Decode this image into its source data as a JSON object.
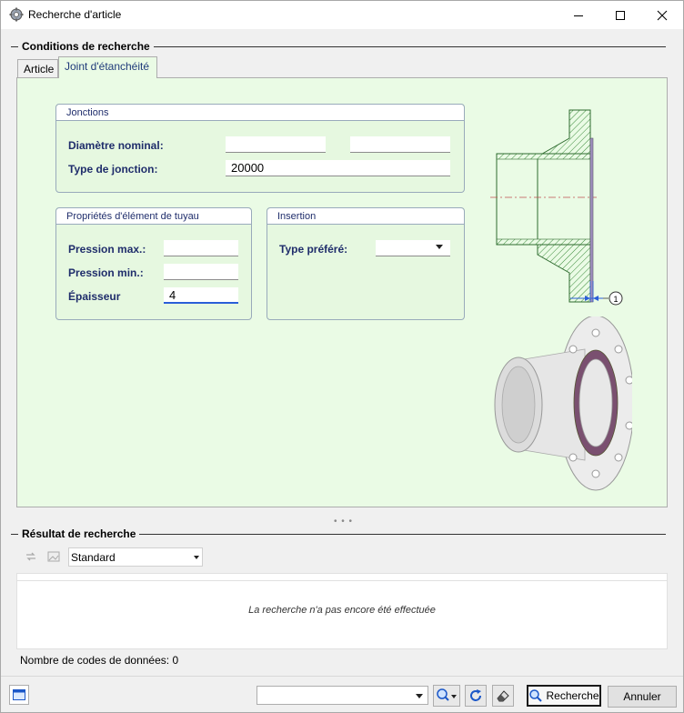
{
  "window": {
    "title": "Recherche d'article"
  },
  "search_conditions": {
    "label": "Conditions de recherche",
    "tabs": [
      {
        "label": "Article",
        "active": false
      },
      {
        "label": "Joint d'étanchéité",
        "active": true
      }
    ],
    "jonctions": {
      "header": "Jonctions",
      "diametre_label": "Diamètre nominal:",
      "diametre_value_1": "",
      "diametre_value_2": "",
      "type_label": "Type de jonction:",
      "type_value": "20000"
    },
    "proprietes": {
      "header": "Propriétés d'élément de tuyau",
      "pression_max_label": "Pression max.:",
      "pression_max_value": "",
      "pression_min_label": "Pression min.:",
      "pression_min_value": "",
      "epaisseur_label": "Épaisseur",
      "epaisseur_value": "4"
    },
    "insertion": {
      "header": "Insertion",
      "type_prefere_label": "Type préféré:",
      "type_prefere_value": ""
    },
    "diagram": {
      "callout": "1"
    }
  },
  "results": {
    "label": "Résultat de recherche",
    "view_combo": "Standard",
    "message": "La recherche n'a pas encore été effectuée",
    "count_text": "Nombre de codes de données: 0"
  },
  "footer": {
    "combo_value": "",
    "search_button": "Recherche",
    "cancel_button": "Annuler"
  },
  "colors": {
    "panel_bg": "#eafbe5",
    "label_blue": "#1f2d6b",
    "focus_blue": "#2a5ed8",
    "hatch_green": "#3a8a3a",
    "gasket_purple": "#7a5070"
  }
}
